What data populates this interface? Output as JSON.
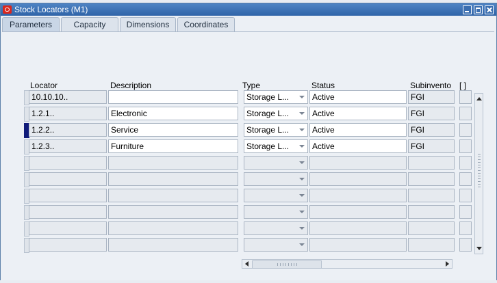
{
  "window": {
    "title": "Stock Locators (M1)"
  },
  "tabs": [
    {
      "label": "Parameters",
      "active": true
    },
    {
      "label": "Capacity",
      "active": false
    },
    {
      "label": "Dimensions",
      "active": false
    },
    {
      "label": "Coordinates",
      "active": false
    }
  ],
  "grid": {
    "headers": {
      "locator": "Locator",
      "description": "Description",
      "type": "Type",
      "status": "Status",
      "subinventory": "Subinvento",
      "flex": "[ ]"
    },
    "rows": [
      {
        "locator": "10.10.10..",
        "description": "",
        "type": "Storage L...",
        "status": "Active",
        "subinventory": "FGI"
      },
      {
        "locator": "1.2.1..",
        "description": "Electronic",
        "type": "Storage L...",
        "status": "Active",
        "subinventory": "FGI"
      },
      {
        "locator": "1.2.2..",
        "description": "Service",
        "type": "Storage L...",
        "status": "Active",
        "subinventory": "FGI",
        "current": true
      },
      {
        "locator": "1.2.3..",
        "description": "Furniture",
        "type": "Storage L...",
        "status": "Active",
        "subinventory": "FGI"
      }
    ],
    "empty_rows": 6
  },
  "colors": {
    "titlebar": "#3a6eb0",
    "current_row_marker": "#101b7a"
  }
}
